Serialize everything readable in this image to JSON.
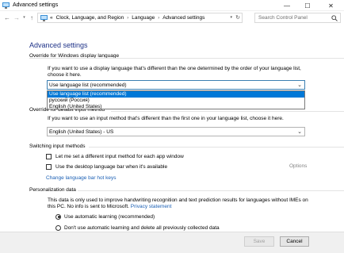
{
  "window": {
    "title": "Advanced settings",
    "minimize_glyph": "—",
    "maximize_glyph": "☐",
    "close_glyph": "✕"
  },
  "address_bar": {
    "back_glyph": "←",
    "forward_glyph": "→",
    "recent_glyph": "▾",
    "up_glyph": "↑",
    "prefix": "«",
    "crumbs": [
      "Clock, Language, and Region",
      "Language",
      "Advanced settings"
    ],
    "separator": "›",
    "dropdown_glyph": "▾",
    "refresh_glyph": "↻",
    "search_placeholder": "Search Control Panel"
  },
  "page": {
    "heading": "Advanced settings"
  },
  "display_language": {
    "section_title": "Override for Windows display language",
    "description": "If you want to use a display language that's different than the one determined by the order of your language list, choose it here.",
    "selected": "Use language list (recommended)",
    "options": [
      "Use language list (recommended)",
      "русский (Россия)",
      "English (United States)"
    ]
  },
  "input_method": {
    "section_title": "Override for default input method",
    "description": "If you want to use an input method that's different than the first one in your language list, choose it here.",
    "selected": "English (United States) - US"
  },
  "switching": {
    "section_title": "Switching input methods",
    "checkbox_1": "Let me set a different input method for each app window",
    "checkbox_2": "Use the desktop language bar when it's available",
    "options_link": "Options",
    "hotkeys_link": "Change language bar hot keys"
  },
  "personalization": {
    "section_title": "Personalization data",
    "description_part1": "This data is only used to improve handwriting recognition and text prediction results for languages without IMEs on this PC. No info is sent to Microsoft.",
    "privacy_link": "Privacy statement",
    "radio_1": "Use automatic learning (recommended)",
    "radio_2": "Don't use automatic learning and delete all previously collected data"
  },
  "buttons": {
    "save": "Save",
    "cancel": "Cancel"
  },
  "colors": {
    "heading": "#1e3287",
    "link": "#1a5fb4",
    "selection": "#0078d7"
  }
}
